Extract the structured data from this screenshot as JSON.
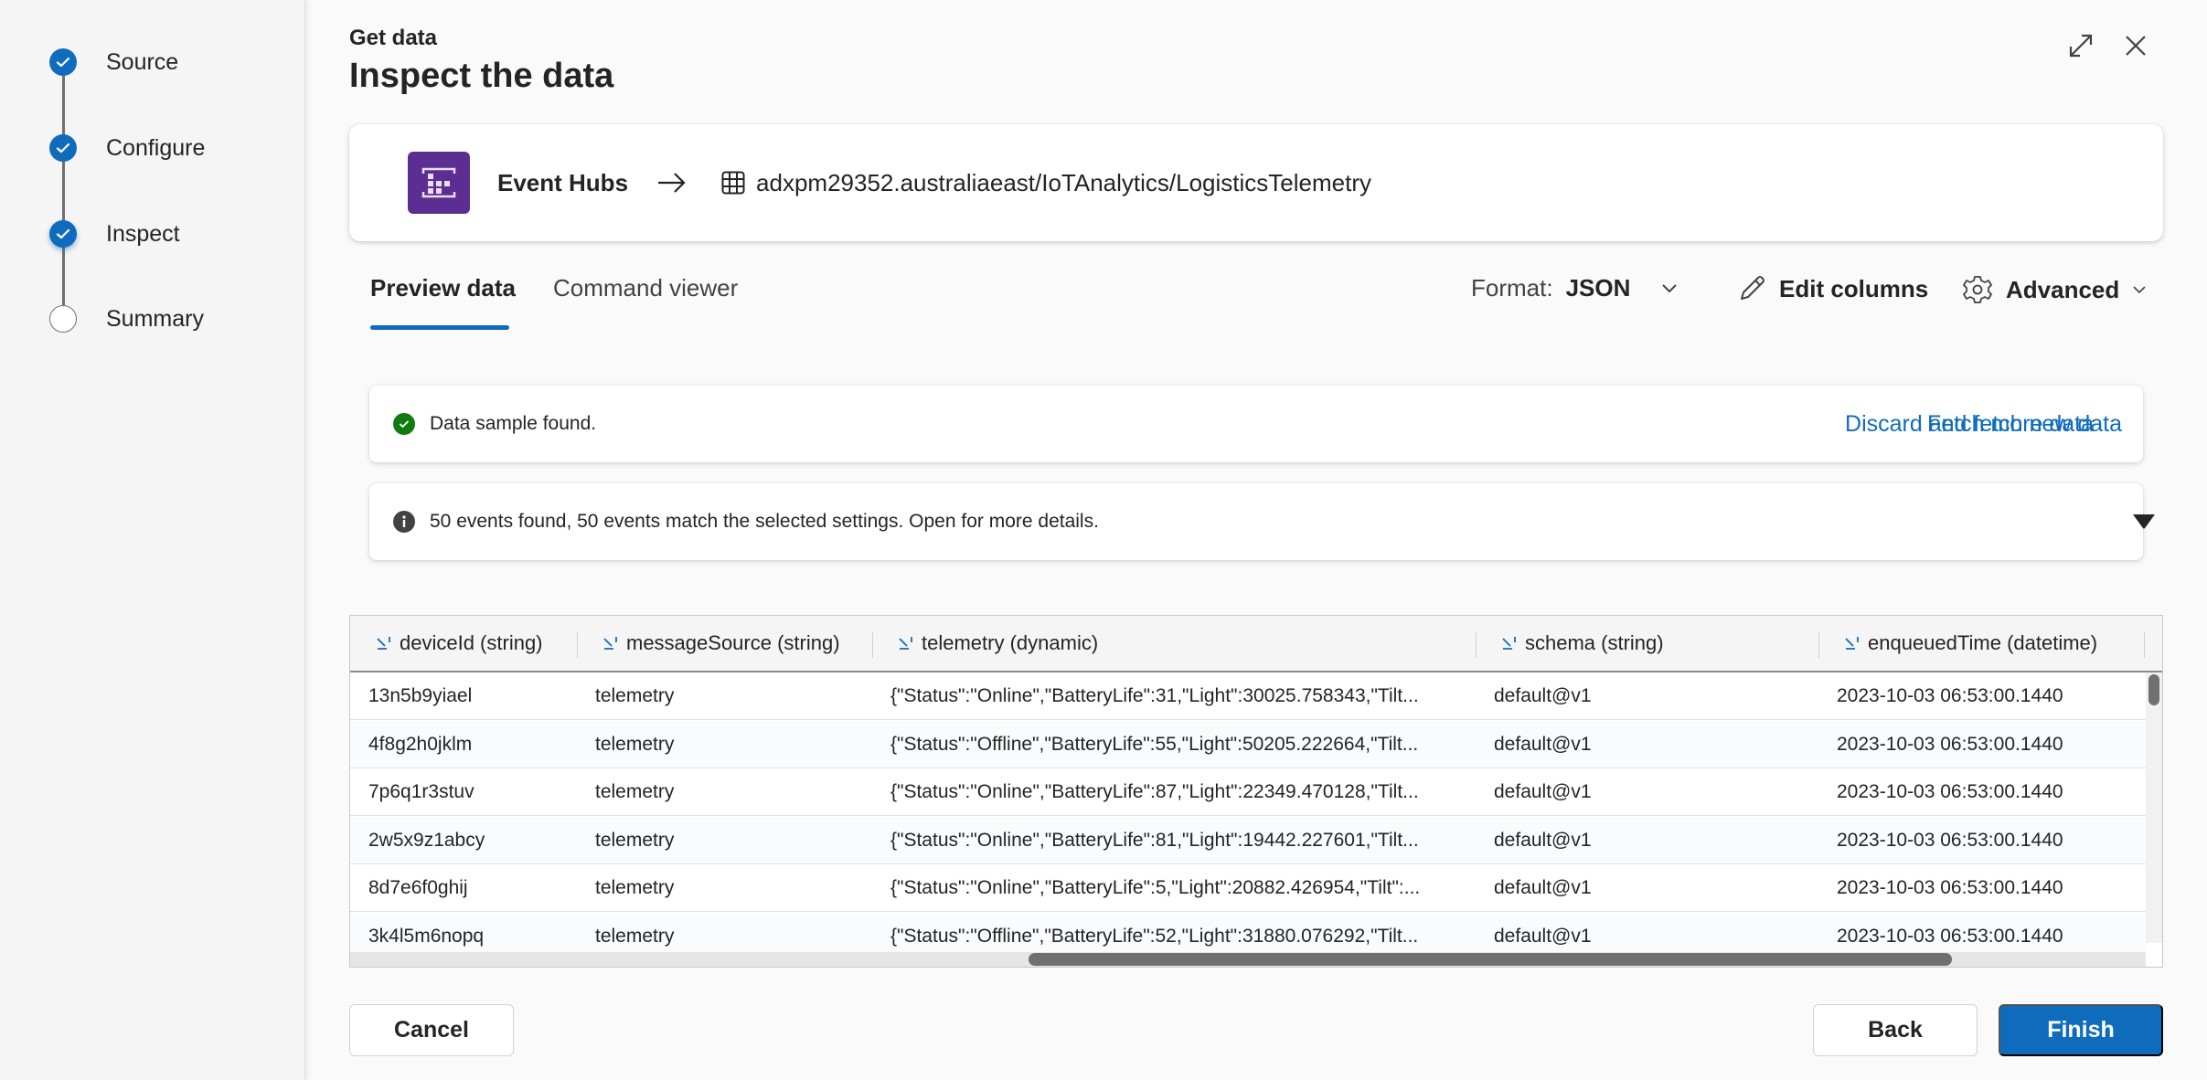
{
  "stepper": {
    "steps": [
      {
        "label": "Source",
        "state": "completed"
      },
      {
        "label": "Configure",
        "state": "completed"
      },
      {
        "label": "Inspect",
        "state": "current"
      },
      {
        "label": "Summary",
        "state": "pending"
      }
    ]
  },
  "header": {
    "kicker": "Get data",
    "title": "Inspect the data",
    "expand_icon": "expand-icon",
    "close_icon": "close-icon"
  },
  "source_card": {
    "source_icon": "event-hubs-icon",
    "source_name": "Event Hubs",
    "arrow_icon": "arrow-right-icon",
    "dest_icon": "table-icon",
    "dest_path": "adxpm29352.australiaeast/IoTAnalytics/LogisticsTelemetry"
  },
  "tabs": [
    {
      "label": "Preview data",
      "active": true
    },
    {
      "label": "Command viewer",
      "active": false
    }
  ],
  "toolbar": {
    "format_label": "Format:",
    "format_value": "JSON",
    "edit_columns_label": "Edit columns",
    "advanced_label": "Advanced"
  },
  "messages": {
    "success": {
      "text": "Data sample found.",
      "icon": "success-check-icon",
      "color": "#107c10",
      "fetch_more_label": "Fetch more data",
      "discard_label": "Discard and fetch new data"
    },
    "info": {
      "text": "50 events found, 50 events match the selected settings. Open for more details.",
      "icon": "info-icon",
      "expand_icon": "caret-down-icon"
    }
  },
  "grid": {
    "columns": [
      "deviceId (string)",
      "messageSource (string)",
      "telemetry (dynamic)",
      "schema (string)",
      "enqueuedTime (datetime)"
    ],
    "rows": [
      [
        "13n5b9yiael",
        "telemetry",
        "{\"Status\":\"Online\",\"BatteryLife\":31,\"Light\":30025.758343,\"Tilt...",
        "default@v1",
        "2023-10-03 06:53:00.1440"
      ],
      [
        "4f8g2h0jklm",
        "telemetry",
        "{\"Status\":\"Offline\",\"BatteryLife\":55,\"Light\":50205.222664,\"Tilt...",
        "default@v1",
        "2023-10-03 06:53:00.1440"
      ],
      [
        "7p6q1r3stuv",
        "telemetry",
        "{\"Status\":\"Online\",\"BatteryLife\":87,\"Light\":22349.470128,\"Tilt...",
        "default@v1",
        "2023-10-03 06:53:00.1440"
      ],
      [
        "2w5x9z1abcy",
        "telemetry",
        "{\"Status\":\"Online\",\"BatteryLife\":81,\"Light\":19442.227601,\"Tilt...",
        "default@v1",
        "2023-10-03 06:53:00.1440"
      ],
      [
        "8d7e6f0ghij",
        "telemetry",
        "{\"Status\":\"Online\",\"BatteryLife\":5,\"Light\":20882.426954,\"Tilt\":...",
        "default@v1",
        "2023-10-03 06:53:00.1440"
      ],
      [
        "3k4l5m6nopq",
        "telemetry",
        "{\"Status\":\"Offline\",\"BatteryLife\":52,\"Light\":31880.076292,\"Tilt...",
        "default@v1",
        "2023-10-03 06:53:00.1440"
      ]
    ]
  },
  "footer": {
    "cancel_label": "Cancel",
    "back_label": "Back",
    "finish_label": "Finish"
  },
  "colors": {
    "accent": "#0f6cbd",
    "event_hubs": "#5c2e91",
    "success": "#107c10"
  }
}
